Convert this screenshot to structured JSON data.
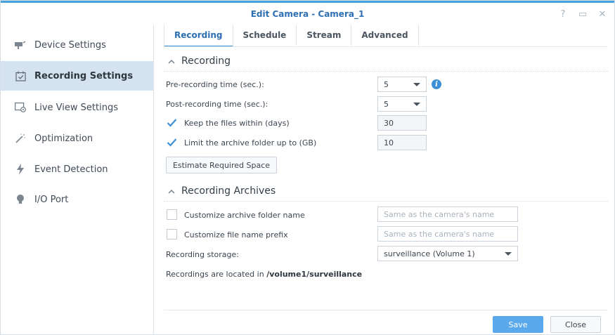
{
  "window": {
    "title": "Edit Camera - Camera_1",
    "help_glyph": "?",
    "maximize_glyph": "▭",
    "close_glyph": "✕"
  },
  "sidebar": {
    "items": [
      {
        "label": "Device Settings",
        "icon": "camera-icon",
        "active": false
      },
      {
        "label": "Recording Settings",
        "icon": "calendar-check-icon",
        "active": true
      },
      {
        "label": "Live View Settings",
        "icon": "live-view-icon",
        "active": false
      },
      {
        "label": "Optimization",
        "icon": "magic-wand-icon",
        "active": false
      },
      {
        "label": "Event Detection",
        "icon": "lightning-icon",
        "active": false
      },
      {
        "label": "I/O Port",
        "icon": "bulb-icon",
        "active": false
      }
    ]
  },
  "tabs": [
    {
      "label": "Recording",
      "active": true
    },
    {
      "label": "Schedule",
      "active": false
    },
    {
      "label": "Stream",
      "active": false
    },
    {
      "label": "Advanced",
      "active": false
    }
  ],
  "recording": {
    "section_title": "Recording",
    "pre_label": "Pre-recording time (sec.):",
    "pre_value": "5",
    "post_label": "Post-recording time (sec.):",
    "post_value": "5",
    "keep_label": "Keep the files within (days)",
    "keep_checked": true,
    "keep_value": "30",
    "limit_label": "Limit the archive folder up to (GB)",
    "limit_checked": true,
    "limit_value": "10",
    "estimate_button": "Estimate Required Space",
    "info_glyph": "i"
  },
  "archives": {
    "section_title": "Recording Archives",
    "custom_folder_label": "Customize archive folder name",
    "custom_folder_checked": false,
    "custom_folder_placeholder": "Same as the camera's name",
    "custom_prefix_label": "Customize file name prefix",
    "custom_prefix_checked": false,
    "custom_prefix_placeholder": "Same as the camera's name",
    "storage_label": "Recording storage:",
    "storage_value": "surveillance (Volume 1)",
    "location_prefix": "Recordings are located in ",
    "location_path": "/volume1/surveillance"
  },
  "footer": {
    "save": "Save",
    "close": "Close"
  },
  "colors": {
    "accent": "#3d8fd6",
    "save_button": "#5aa9ec",
    "sidebar_active": "#d4e3ef",
    "title": "#2d6fb4"
  }
}
